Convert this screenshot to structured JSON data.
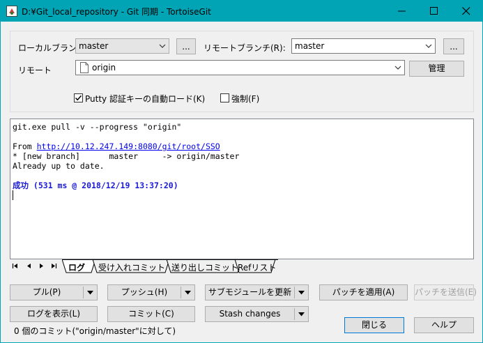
{
  "window": {
    "title": "D:¥Git_local_repository - Git 同期 - TortoiseGit",
    "accent": "#00a4b4"
  },
  "branch": {
    "local_label": "ローカルブランチ",
    "local_value": "master",
    "browse_label": "...",
    "remote_branch_label": "リモートブランチ(R):",
    "remote_branch_value": "master",
    "remote_label": "リモート",
    "remote_value": "origin",
    "manage_label": "管理",
    "putty_label": "Putty 認証キーの自動ロード(K)",
    "putty_checked": true,
    "force_label": "強制(F)",
    "force_checked": false
  },
  "log": {
    "command": "git.exe pull -v --progress \"origin\"",
    "from_prefix": "From ",
    "from_url": "http://10.12.247.149:8080/git/root/SSO",
    "branch_line": "* [new branch]      master     -> origin/master",
    "status_line": "Already up to date.",
    "success_line": "成功 (531 ms @ 2018/12/19 13:37:20)"
  },
  "tabs": [
    {
      "label": "ログ",
      "active": true
    },
    {
      "label": "受け入れコミット",
      "active": false
    },
    {
      "label": "送り出しコミット",
      "active": false
    },
    {
      "label": "Refリスト",
      "active": false
    }
  ],
  "buttons": {
    "pull": "プル(P)",
    "push": "プッシュ(H)",
    "submodule_update": "サブモジュールを更新",
    "apply_patch": "パッチを適用(A)",
    "send_patch": "パッチを送信(E)",
    "show_log": "ログを表示(L)",
    "commit": "コミット(C)",
    "stash": "Stash changes",
    "close": "閉じる",
    "help": "ヘルプ"
  },
  "status": {
    "commit_count": "0 個のコミット(\"origin/master\"に対して)"
  },
  "icons": [
    "tortoisegit-icon",
    "minimize-icon",
    "maximize-icon",
    "close-icon",
    "chevron-down-icon",
    "file-icon",
    "check-icon"
  ]
}
